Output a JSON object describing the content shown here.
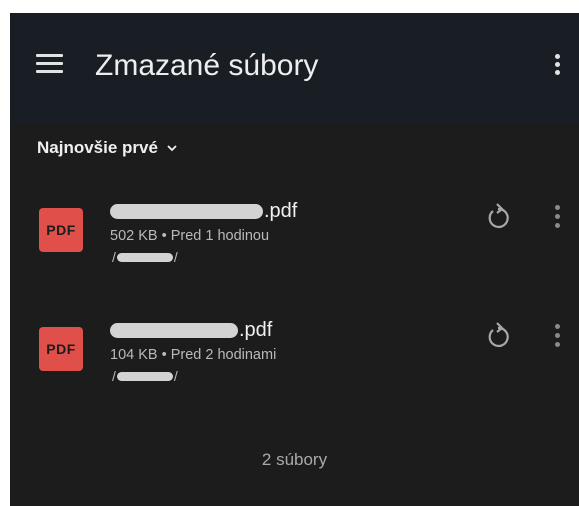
{
  "app_bar": {
    "title": "Zmazané súbory",
    "menu_icon": "hamburger-menu-icon",
    "more_icon": "more-vert-icon"
  },
  "sort": {
    "label": "Najnovšie prvé",
    "icon": "chevron-down-icon"
  },
  "files": [
    {
      "type_badge": "PDF",
      "name_suffix": ".pdf",
      "meta": "502 KB • Pred 1 hodinou",
      "path_prefix": "/",
      "path_suffix": "/"
    },
    {
      "type_badge": "PDF",
      "name_suffix": ".pdf",
      "meta": "104 KB • Pred 2 hodinami",
      "path_prefix": "/",
      "path_suffix": "/"
    }
  ],
  "footer": {
    "count": "2 súbory"
  },
  "colors": {
    "app_bar_bg": "#191d24",
    "background": "#1c1c1c",
    "pdf_badge": "#e04f4a"
  }
}
